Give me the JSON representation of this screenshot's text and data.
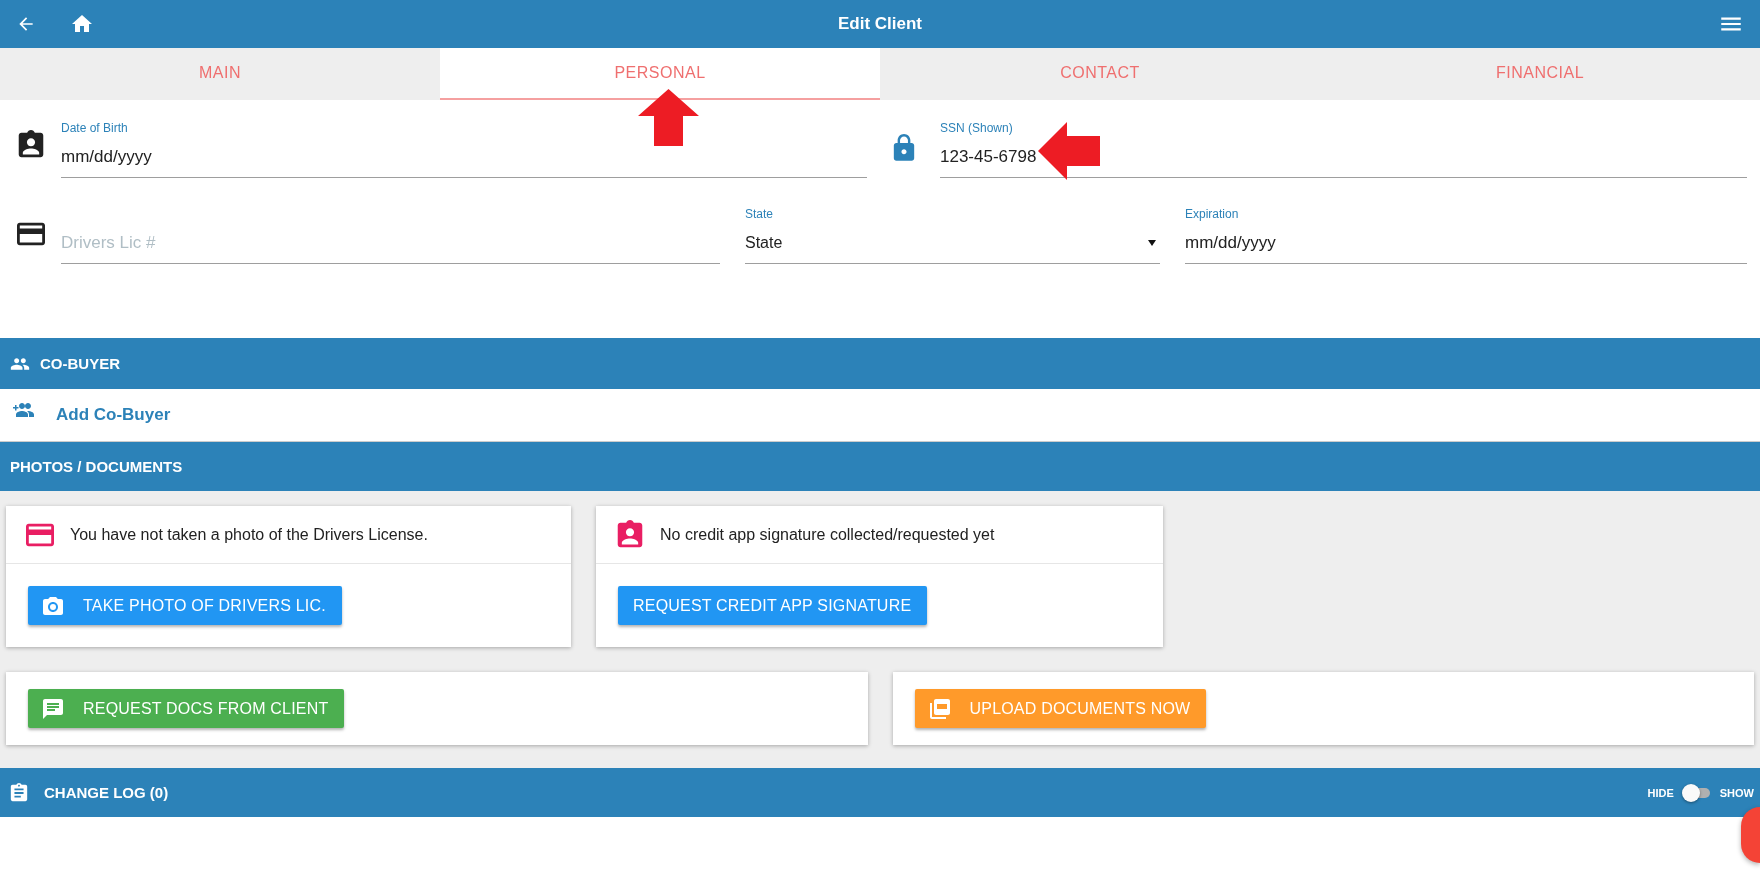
{
  "app_bar": {
    "title": "Edit Client"
  },
  "tabs": [
    {
      "label": "MAIN",
      "selected": false
    },
    {
      "label": "PERSONAL",
      "selected": true
    },
    {
      "label": "CONTACT",
      "selected": false
    },
    {
      "label": "FINANCIAL",
      "selected": false
    }
  ],
  "personal": {
    "date_of_birth": {
      "label": "Date of Birth",
      "value": "mm/dd/yyyy"
    },
    "ssn": {
      "label": "SSN (Shown)",
      "value": "123-45-6798"
    },
    "drivers_lic": {
      "placeholder": "Drivers Lic #"
    },
    "state": {
      "label": "State",
      "value": "State"
    },
    "expiration": {
      "label": "Expiration",
      "value": "mm/dd/yyyy"
    }
  },
  "co_buyer": {
    "title": "CO-BUYER",
    "add_link": "Add Co-Buyer"
  },
  "photos_documents": {
    "title": "PHOTOS / DOCUMENTS",
    "cards": [
      {
        "message": "You have not taken a photo of the Drivers License.",
        "button": "TAKE PHOTO OF DRIVERS LIC."
      },
      {
        "message": "No credit app signature collected/requested yet",
        "button": "REQUEST CREDIT APP SIGNATURE"
      }
    ],
    "actions": [
      {
        "button": "REQUEST DOCS FROM CLIENT",
        "color": "#4caf50"
      },
      {
        "button": "UPLOAD DOCUMENTS NOW",
        "color": "#ff9a2a"
      }
    ]
  },
  "change_log": {
    "title": "CHANGE LOG (0)",
    "toggle": {
      "off_label": "HIDE",
      "on_label": "SHOW",
      "on": false
    }
  }
}
